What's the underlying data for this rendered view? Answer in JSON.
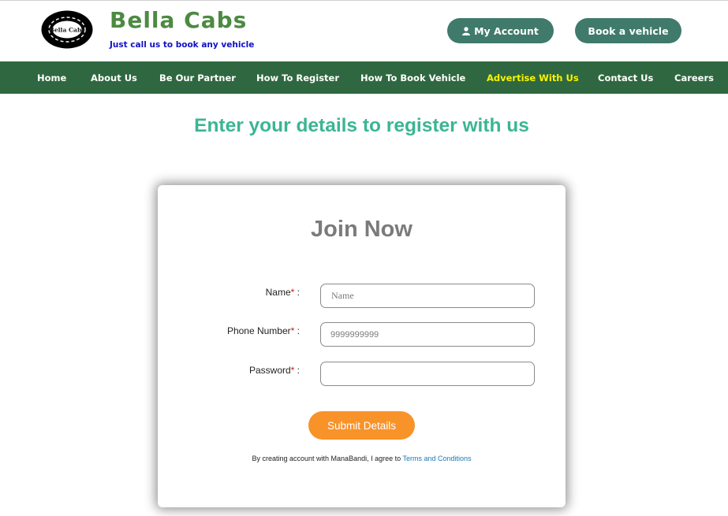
{
  "brand": {
    "logo_text": "Bella Cabs",
    "title": "Bella Cabs",
    "tagline": "Just call us to book any vehicle"
  },
  "header_buttons": {
    "account": "My Account",
    "book": "Book a vehicle"
  },
  "nav": {
    "items": [
      {
        "label": "Home"
      },
      {
        "label": "About Us"
      },
      {
        "label": "Be Our Partner"
      },
      {
        "label": "How To Register"
      },
      {
        "label": "How To Book Vehicle"
      },
      {
        "label": "Advertise With Us"
      },
      {
        "label": "Contact Us"
      },
      {
        "label": "Careers"
      }
    ]
  },
  "page": {
    "heading": "Enter your details to register with us"
  },
  "form": {
    "title": "Join Now",
    "required_mark": "*",
    "label_suffix": " :",
    "name": {
      "label": "Name",
      "placeholder": "Name",
      "value": ""
    },
    "phone": {
      "label": "Phone Number",
      "placeholder": "9999999999",
      "value": ""
    },
    "password": {
      "label": "Password",
      "placeholder": "",
      "value": ""
    },
    "submit_label": "Submit Details",
    "terms_prefix": "By creating account with ManaBandi, I agree to ",
    "terms_link": "Terms and Conditions"
  },
  "colors": {
    "brand_green": "#4c8a41",
    "nav_bg": "#2f6840",
    "nav_highlight": "#f8f400",
    "pill_bg": "#3f7a6a",
    "heading_teal": "#3bb593",
    "submit_orange": "#f89329",
    "tagline_blue": "#1010c8",
    "link_blue": "#1a7ab8"
  },
  "icons": {
    "logo": "bella-cabs-tyre-logo",
    "account": "user-icon"
  }
}
